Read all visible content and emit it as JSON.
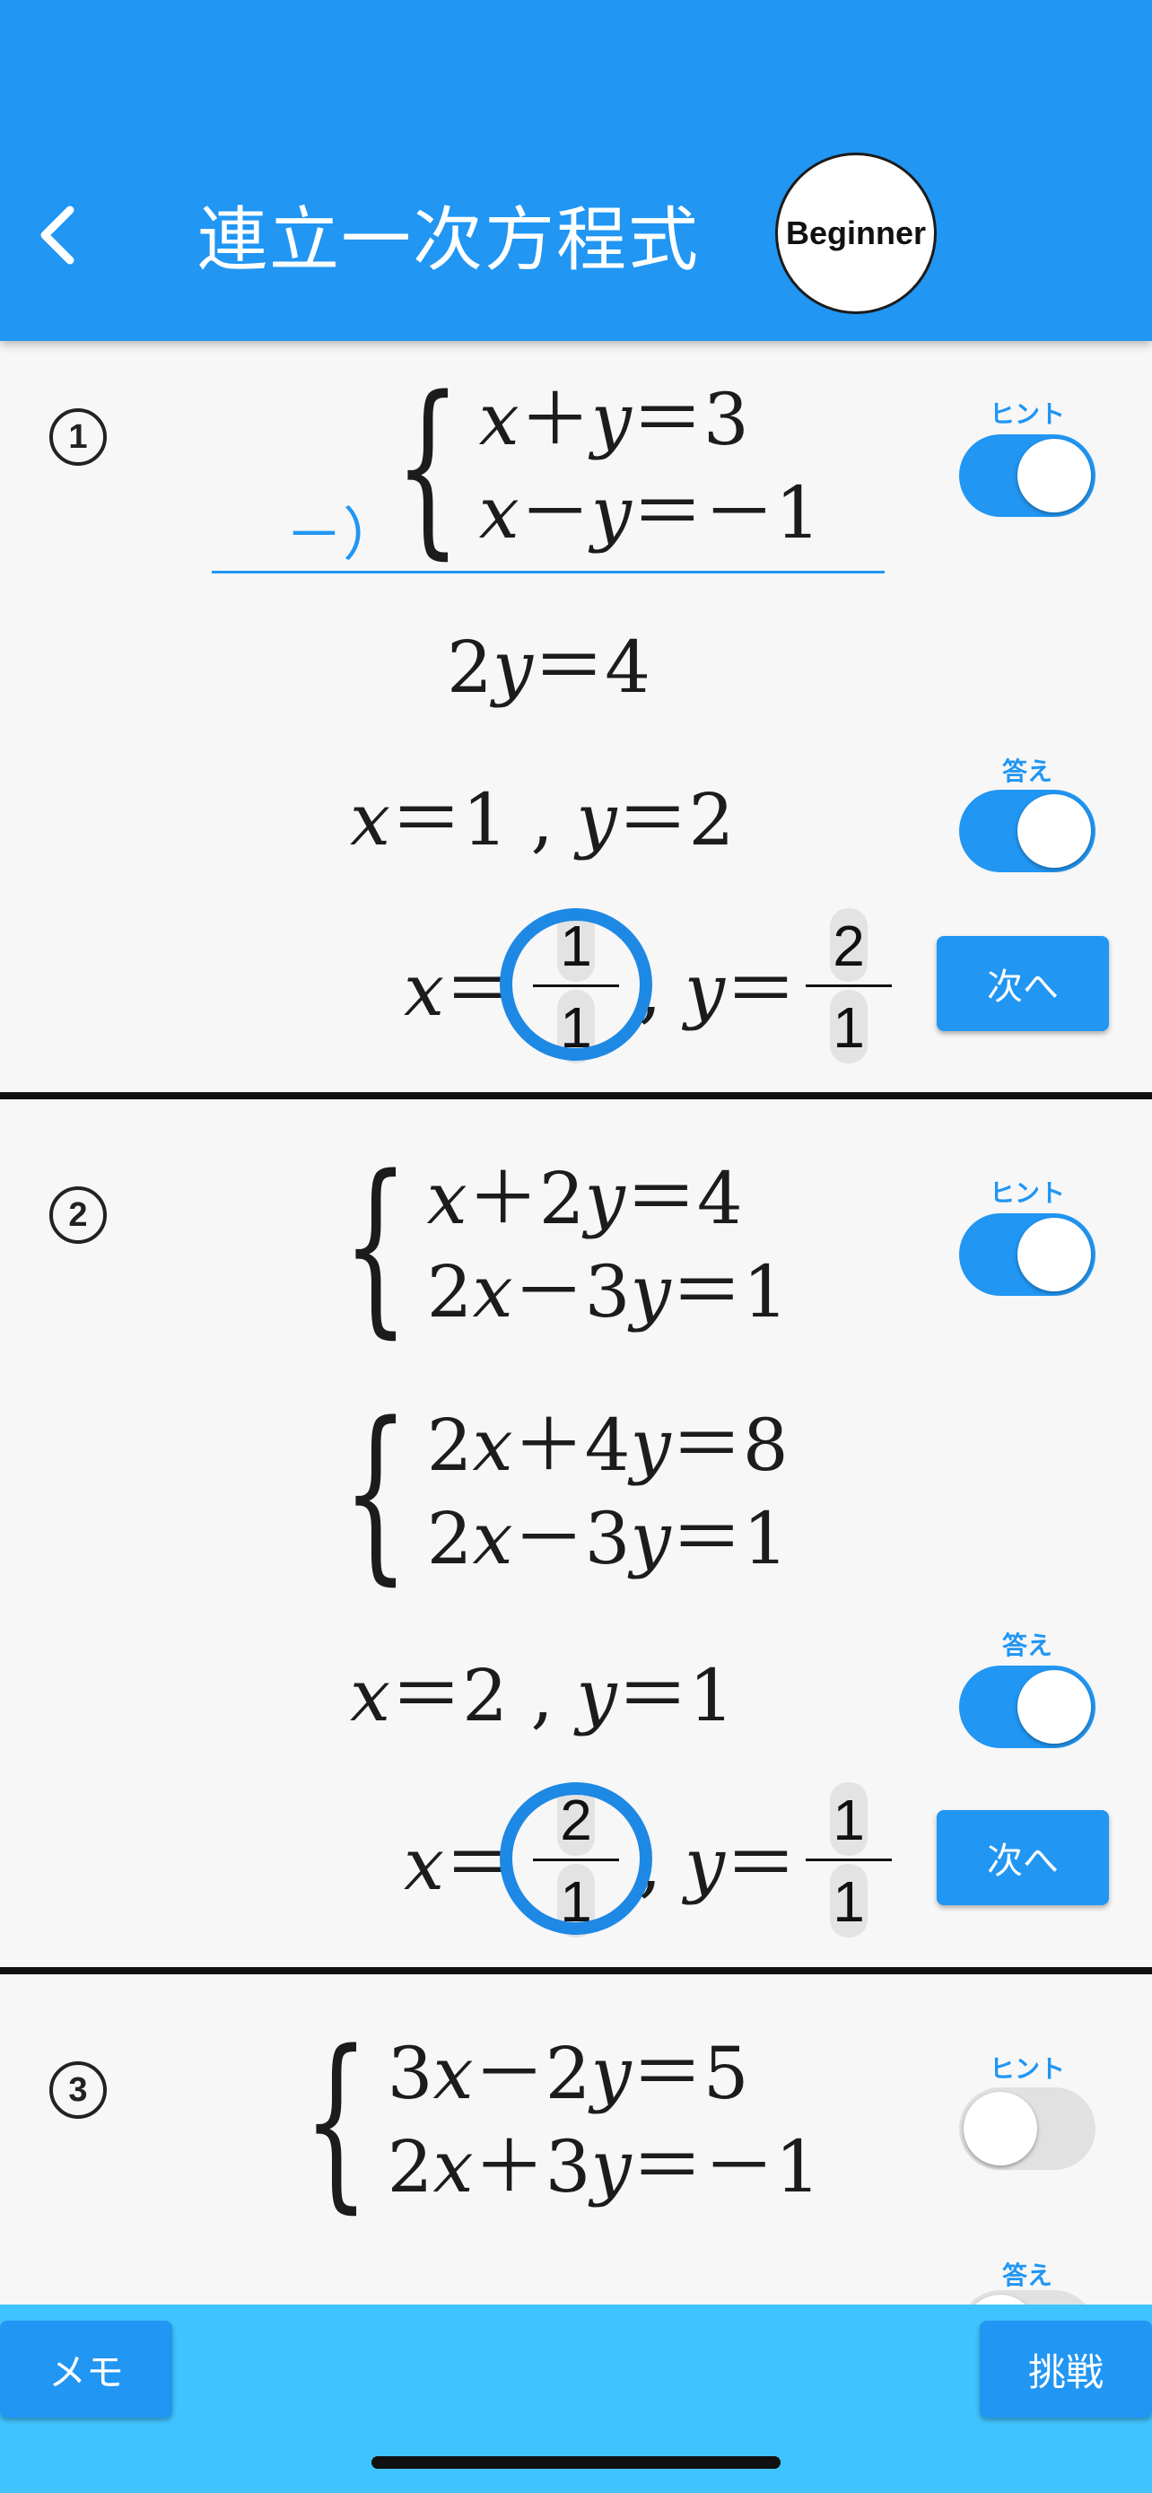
{
  "header": {
    "title": "連立一次方程式",
    "badge": "Beginner",
    "back_icon": "chevron-left-icon"
  },
  "labels": {
    "hint": "ヒント",
    "answer": "答え",
    "next": "次へ"
  },
  "problems": [
    {
      "number": "1",
      "equations": [
        "x＋y＝3",
        "x－y＝－1"
      ],
      "operator": "－）",
      "work": [
        "2y＝4"
      ],
      "answer_text": "x＝1 , y＝2",
      "hint_on": true,
      "answer_on": true,
      "input": {
        "x_num": "1",
        "x_den": "1",
        "y_num": "2",
        "y_den": "1"
      }
    },
    {
      "number": "2",
      "equations": [
        "x＋2y＝4",
        "2x－3y＝1"
      ],
      "work": [
        "2x＋4y＝8",
        "2x－3y＝1"
      ],
      "answer_text": "x＝2 , y＝1",
      "hint_on": true,
      "answer_on": true,
      "input": {
        "x_num": "2",
        "x_den": "1",
        "y_num": "1",
        "y_den": "1"
      }
    },
    {
      "number": "3",
      "equations": [
        "3x－2y＝5",
        "2x＋3y＝－1"
      ],
      "hint_on": false,
      "answer_on": false
    }
  ],
  "footer": {
    "memo": "メモ",
    "challenge": "挑戦"
  },
  "colors": {
    "accent": "#2196f3",
    "footer": "#40c4ff",
    "ring": "#1e88e5"
  }
}
